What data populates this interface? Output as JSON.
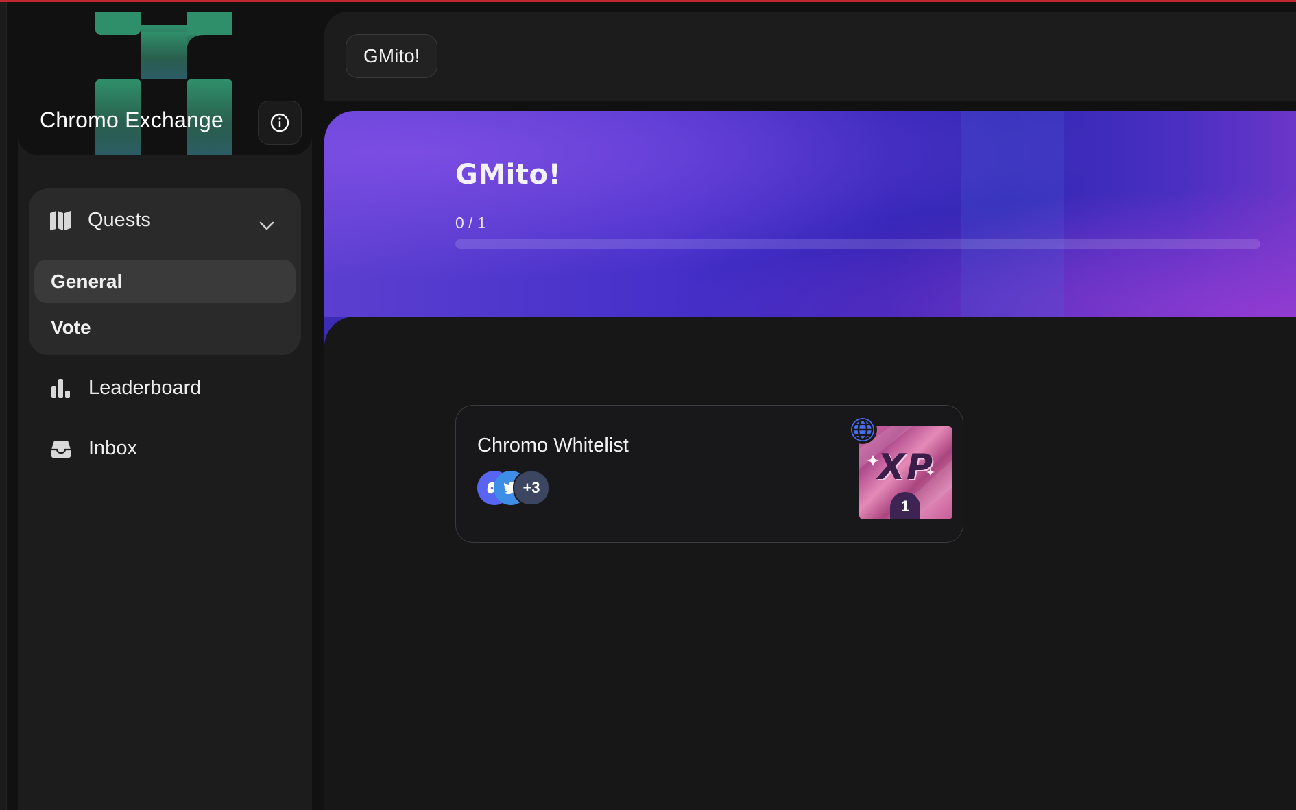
{
  "app": {
    "brand_name": "Chromo Exchange",
    "accent_color": "#4630c9",
    "logo_color": "#2f8f6a"
  },
  "sidebar": {
    "quests": {
      "label": "Quests",
      "icon": "map-icon",
      "expanded": true,
      "items": [
        {
          "label": "General",
          "active": true
        },
        {
          "label": "Vote",
          "active": false
        }
      ]
    },
    "items": [
      {
        "label": "Leaderboard",
        "icon": "leaderboard-icon"
      },
      {
        "label": "Inbox",
        "icon": "inbox-icon"
      }
    ]
  },
  "header": {
    "breadcrumb": "GMito!"
  },
  "banner": {
    "title": "GMito!",
    "progress_text": "0 / 1",
    "progress_value": 0
  },
  "quest_card": {
    "title": "Chromo Whitelist",
    "extra_count": "+3",
    "reward_label": "XP",
    "reward_count": "1",
    "platform_icons": [
      "discord-icon",
      "twitter-icon"
    ],
    "badge_icon": "globe-icon"
  }
}
